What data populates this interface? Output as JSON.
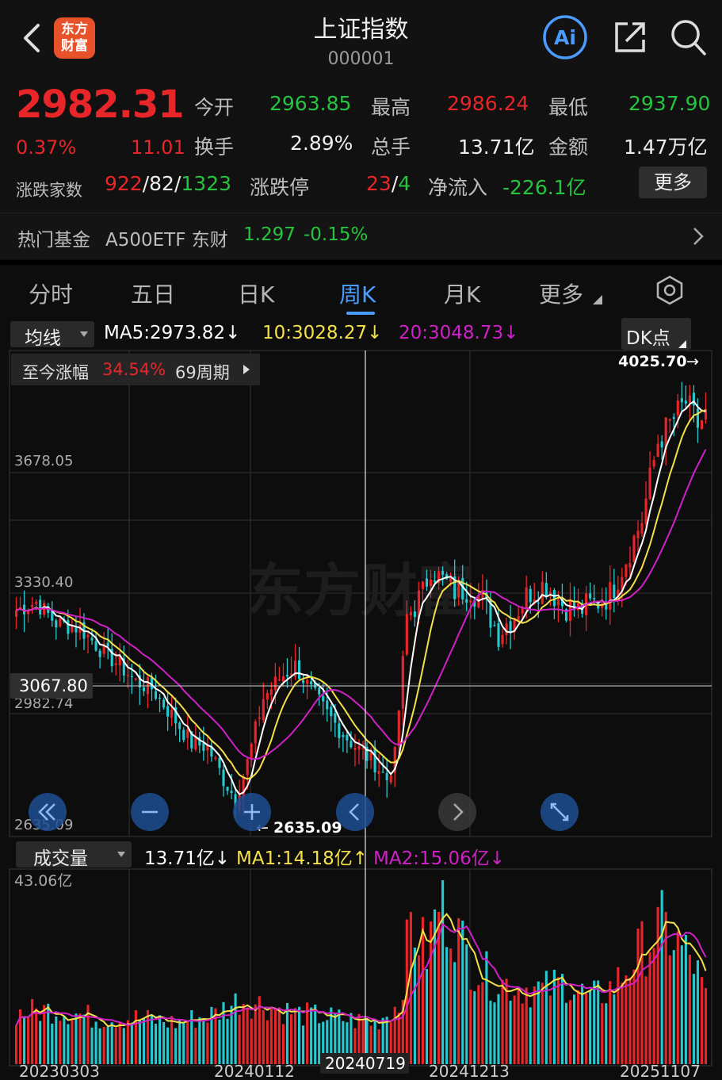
{
  "header": {
    "logo_line1": "东方",
    "logo_line2": "财富",
    "title": "上证指数",
    "code": "000001",
    "ai_label": "Ai"
  },
  "quote": {
    "price": "2982.31",
    "change_pct": "0.37%",
    "change_abs": "11.01",
    "open_label": "今开",
    "open_value": "2963.85",
    "high_label": "最高",
    "high_value": "2986.24",
    "low_label": "最低",
    "low_value": "2937.90",
    "turnover_label": "换手",
    "turnover_value": "2.89%",
    "volume_label": "总手",
    "volume_value": "13.71亿",
    "amount_label": "金额",
    "amount_value": "1.47万亿",
    "breadth_label": "涨跌家数",
    "breadth_up": "922",
    "breadth_flat": "82",
    "breadth_down": "1323",
    "limit_label": "涨跌停",
    "limit_up": "23",
    "limit_down": "4",
    "inflow_label": "净流入",
    "inflow_value": "-226.1亿",
    "more_button": "更多"
  },
  "fund": {
    "label": "热门基金",
    "name": "A500ETF 东财",
    "price": "1.297",
    "change": "-0.15%"
  },
  "tabs": [
    {
      "label": "分时"
    },
    {
      "label": "五日"
    },
    {
      "label": "日K"
    },
    {
      "label": "周K",
      "active": true
    },
    {
      "label": "月K"
    },
    {
      "label": "更多"
    }
  ],
  "indicators": {
    "selector": "均线",
    "ma5": "MA5:2973.82↓",
    "ma10": "10:3028.27↓",
    "ma20": "20:3048.73↓",
    "dk_button": "DK点",
    "range_label": "至今涨幅",
    "range_pct": "34.54%",
    "range_weeks": "69周期"
  },
  "volume_panel": {
    "selector": "成交量",
    "current": "13.71亿↓",
    "ma1": "MA1:14.18亿↑",
    "ma2": "MA2:15.06亿↓",
    "max_label": "43.06亿"
  },
  "colors": {
    "up": "#e8262a",
    "down": "#27c9d0",
    "ma5": "#ffffff",
    "ma10": "#f4e14a",
    "ma20": "#d020c8",
    "active_tab": "#4a9cff"
  },
  "chart_data": {
    "type": "candlestick",
    "price_axis_labels": [
      "3678.05",
      "3330.40",
      "2982.74",
      "2635.09"
    ],
    "crosshair_price": "3067.80",
    "max_marker": "4025.70",
    "min_marker": "2635.09",
    "x_labels": [
      "20230303",
      "20240112",
      "20240719",
      "20241213",
      "20251107"
    ],
    "ylim": [
      2590,
      4070
    ],
    "ma_series": [
      {
        "name": "MA5",
        "color": "#ffffff"
      },
      {
        "name": "MA10",
        "color": "#f4e14a"
      },
      {
        "name": "MA20",
        "color": "#d020c8"
      }
    ],
    "close_anchors": [
      [
        0,
        3280
      ],
      [
        5,
        3305
      ],
      [
        10,
        3240
      ],
      [
        16,
        3225
      ],
      [
        22,
        3150
      ],
      [
        26,
        3110
      ],
      [
        30,
        3060
      ],
      [
        34,
        3040
      ],
      [
        40,
        2940
      ],
      [
        44,
        2870
      ],
      [
        48,
        2860
      ],
      [
        52,
        2760
      ],
      [
        55,
        2700
      ],
      [
        58,
        2810
      ],
      [
        62,
        3010
      ],
      [
        66,
        3070
      ],
      [
        70,
        3110
      ],
      [
        74,
        3030
      ],
      [
        78,
        2960
      ],
      [
        82,
        2900
      ],
      [
        86,
        2850
      ],
      [
        90,
        2810
      ],
      [
        93,
        2760
      ],
      [
        95,
        2830
      ],
      [
        98,
        3260
      ],
      [
        102,
        3330
      ],
      [
        104,
        3420
      ],
      [
        106,
        3380
      ],
      [
        110,
        3340
      ],
      [
        114,
        3350
      ],
      [
        117,
        3310
      ],
      [
        121,
        3210
      ],
      [
        125,
        3270
      ],
      [
        129,
        3340
      ],
      [
        133,
        3360
      ],
      [
        137,
        3300
      ],
      [
        141,
        3280
      ],
      [
        145,
        3300
      ],
      [
        149,
        3330
      ],
      [
        153,
        3440
      ],
      [
        157,
        3560
      ],
      [
        161,
        3800
      ],
      [
        165,
        3870
      ],
      [
        168,
        3920
      ],
      [
        171,
        3850
      ],
      [
        173,
        3880
      ]
    ],
    "volume_anchors": [
      [
        0,
        11
      ],
      [
        10,
        12
      ],
      [
        20,
        10
      ],
      [
        30,
        10
      ],
      [
        40,
        9
      ],
      [
        50,
        11
      ],
      [
        56,
        14
      ],
      [
        62,
        13
      ],
      [
        70,
        11
      ],
      [
        80,
        10
      ],
      [
        90,
        9
      ],
      [
        96,
        13
      ],
      [
        99,
        31
      ],
      [
        103,
        24
      ],
      [
        106,
        35
      ],
      [
        110,
        30
      ],
      [
        114,
        22
      ],
      [
        120,
        18
      ],
      [
        126,
        17
      ],
      [
        132,
        16
      ],
      [
        138,
        18
      ],
      [
        144,
        14
      ],
      [
        150,
        17
      ],
      [
        156,
        24
      ],
      [
        162,
        30
      ],
      [
        166,
        26
      ],
      [
        170,
        22
      ],
      [
        173,
        14
      ]
    ]
  }
}
